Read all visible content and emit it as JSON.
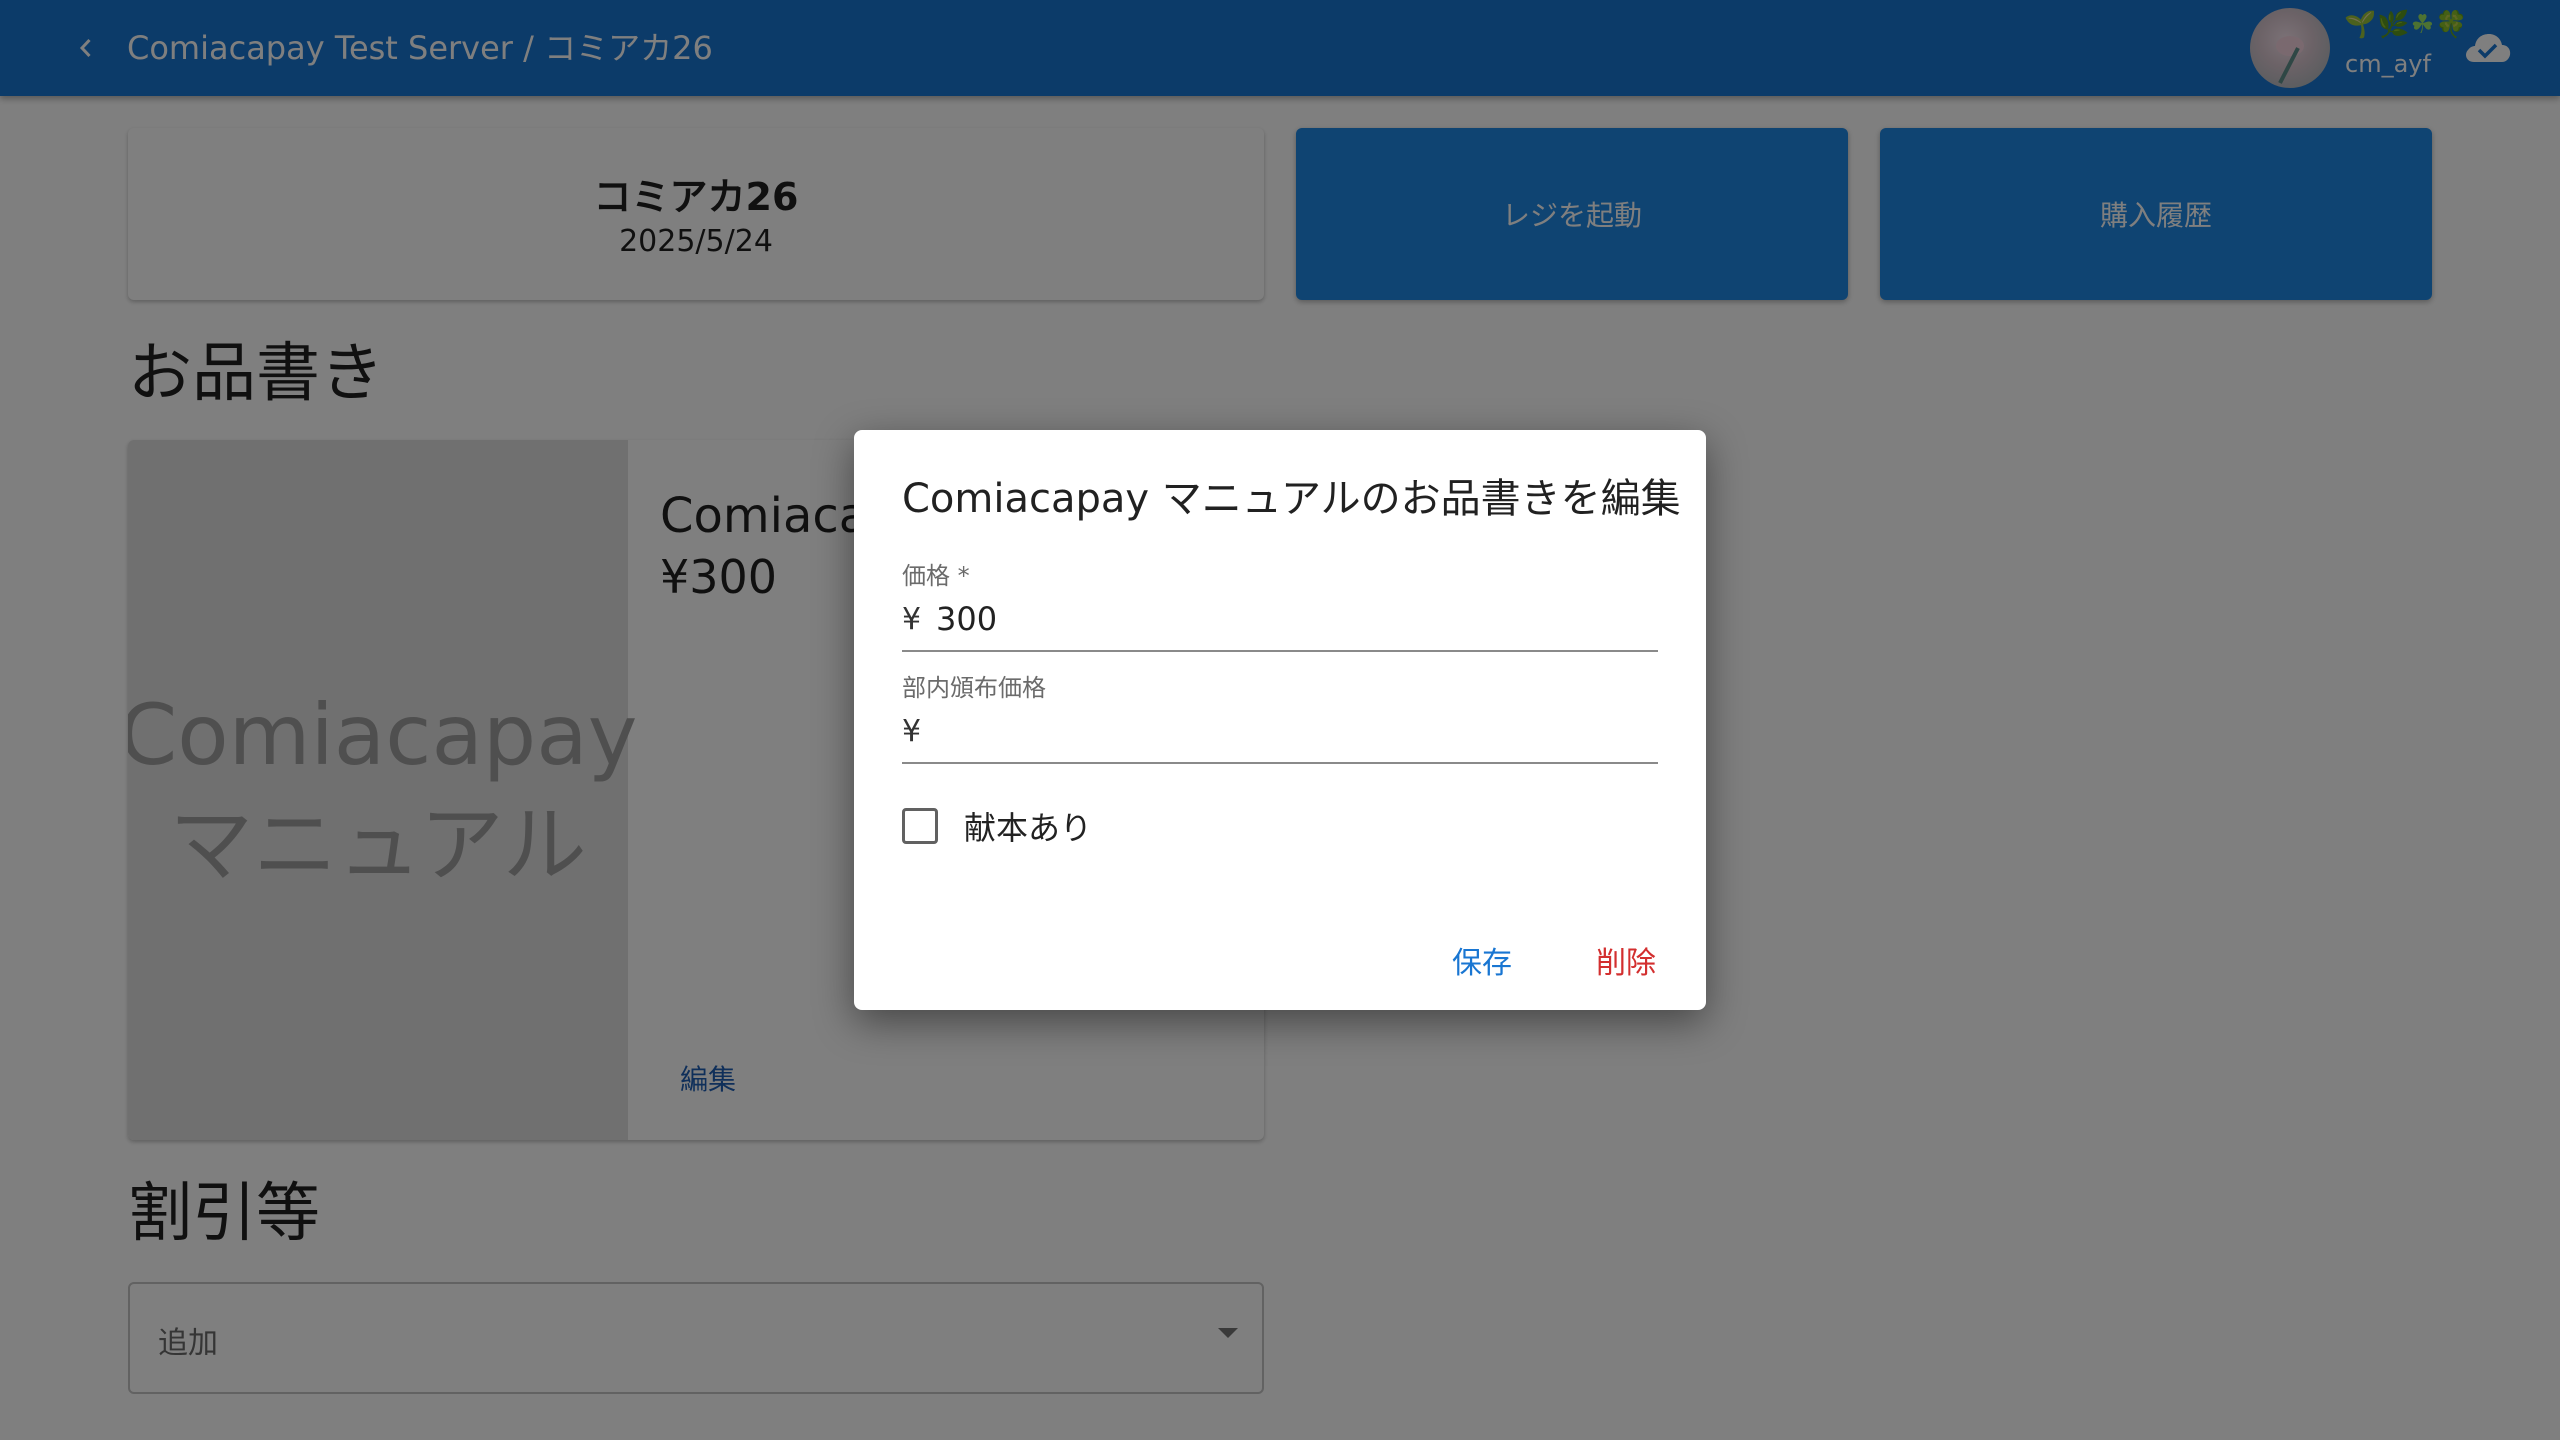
{
  "appbar": {
    "title": "Comiacapay Test Server / コミアカ26",
    "user_decoration": "🌱🌿☘🍀",
    "user_name": "cm_ayf"
  },
  "event": {
    "name": "コミアカ26",
    "date": "2025/5/24"
  },
  "actions": {
    "register_label": "レジを起動",
    "history_label": "購入履歴"
  },
  "sections": {
    "menu_heading": "お品書き",
    "discount_heading": "割引等"
  },
  "item": {
    "cover_line1": "Comiacapay",
    "cover_line2": "マニュアル",
    "name": "Comiacapay マニュアル",
    "price": "¥300",
    "edit_label": "編集"
  },
  "discount": {
    "select_label": "追加"
  },
  "dialog": {
    "title": "Comiacapay マニュアルのお品書きを編集",
    "price_label": "価格 *",
    "price_prefix": "¥",
    "price_value": "300",
    "internal_price_label": "部内頒布価格",
    "internal_price_prefix": "¥",
    "internal_price_value": "",
    "gift_label": "献本あり",
    "gift_checked": false,
    "save_label": "保存",
    "delete_label": "削除"
  },
  "colors": {
    "primary": "#1976d2",
    "action_button": "#1e88e5",
    "delete": "#d32f2f"
  }
}
